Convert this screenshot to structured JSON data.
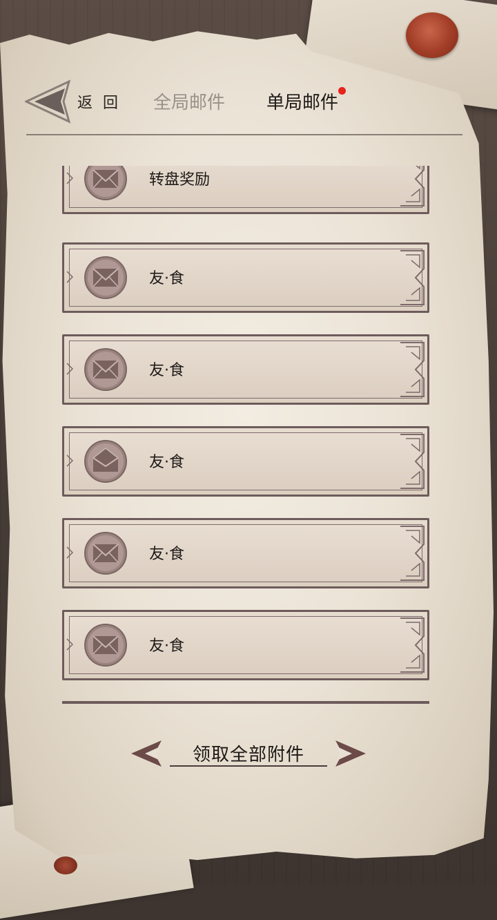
{
  "header": {
    "back_label": "返 回",
    "tabs": [
      {
        "label": "全局邮件",
        "active": false
      },
      {
        "label": "单局邮件",
        "active": true,
        "has_notification": true
      }
    ]
  },
  "mail_list": {
    "items": [
      {
        "title": "转盘奖励",
        "icon": "envelope-closed-icon"
      },
      {
        "title": "友·食",
        "icon": "envelope-closed-icon"
      },
      {
        "title": "友·食",
        "icon": "envelope-closed-icon"
      },
      {
        "title": "友·食",
        "icon": "envelope-open-icon"
      },
      {
        "title": "友·食",
        "icon": "envelope-closed-icon"
      },
      {
        "title": "友·食",
        "icon": "envelope-closed-icon"
      }
    ]
  },
  "footer": {
    "claim_all_label": "领取全部附件"
  },
  "colors": {
    "notification_dot": "#e8231b",
    "frame": "#6d5b5b",
    "inactive_tab": "#9a918a",
    "active_tab": "#1e1a17"
  }
}
